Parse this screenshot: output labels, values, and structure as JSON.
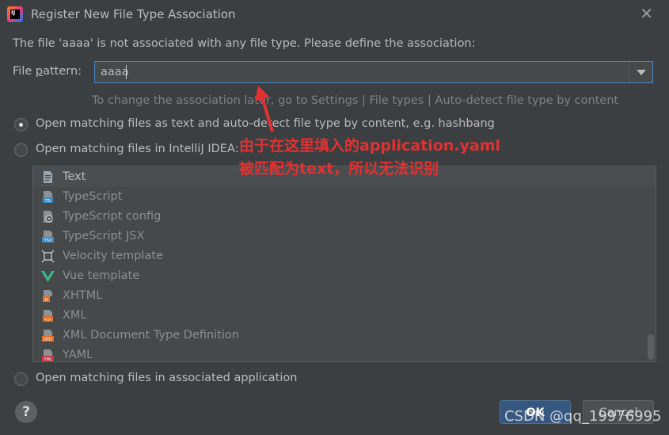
{
  "window": {
    "title": "Register New File Type Association",
    "app_icon_text": "IJ"
  },
  "dialog": {
    "info": "The file 'aaaa' is not associated with any file type. Please define the association:",
    "pattern_label_before": "File ",
    "pattern_label_mnemonic": "p",
    "pattern_label_after": "attern:",
    "pattern_value": "aaaa",
    "hint": "To change the association later, go to Settings | File types | Auto-detect file type by content",
    "options": [
      {
        "label": "Open matching files as text and auto-detect file type by content, e.g. hashbang",
        "checked": true
      },
      {
        "label": "Open matching files in IntelliJ IDEA:",
        "checked": false
      },
      {
        "label": "Open matching files in associated application",
        "checked": false
      }
    ],
    "file_types": [
      {
        "label": "Text",
        "icon": "text-file-icon",
        "selected": true
      },
      {
        "label": "TypeScript",
        "icon": "typescript-file-icon"
      },
      {
        "label": "TypeScript config",
        "icon": "typescript-config-icon"
      },
      {
        "label": "TypeScript JSX",
        "icon": "typescript-jsx-icon"
      },
      {
        "label": "Velocity template",
        "icon": "velocity-template-icon"
      },
      {
        "label": "Vue template",
        "icon": "vue-icon"
      },
      {
        "label": "XHTML",
        "icon": "xhtml-file-icon"
      },
      {
        "label": "XML",
        "icon": "xml-file-icon"
      },
      {
        "label": "XML Document Type Definition",
        "icon": "dtd-file-icon"
      },
      {
        "label": "YAML",
        "icon": "yaml-file-icon"
      }
    ],
    "buttons": {
      "help": "?",
      "ok": "OK",
      "cancel": "Cancel"
    }
  },
  "annotation": {
    "line1": "由于在这里填入的application.yaml",
    "line2": "被匹配为text，所以无法识别",
    "color": "#e23131"
  },
  "watermark": "CSDN @qq_19976995",
  "colors": {
    "background": "#3c3f41",
    "input_border": "#4a88c7",
    "ok_button": "#365880",
    "text": "#bbbbbb"
  }
}
